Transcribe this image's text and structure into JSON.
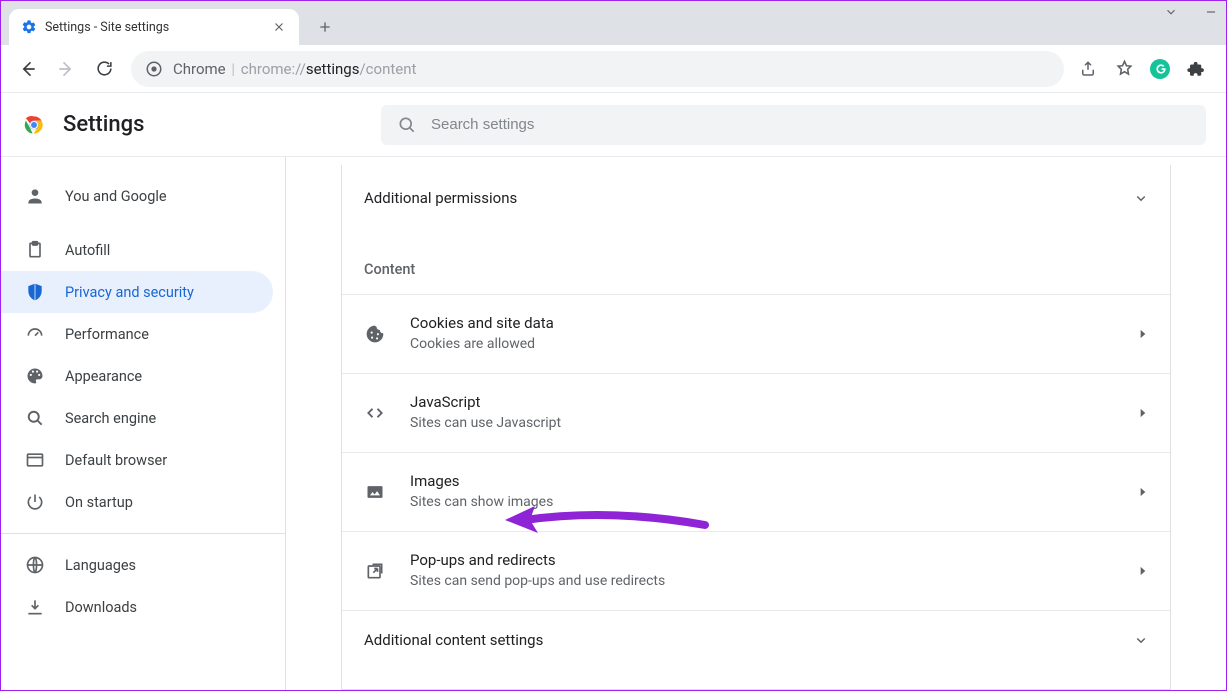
{
  "window": {
    "tab_title": "Settings - Site settings"
  },
  "toolbar": {
    "url_host": "Chrome",
    "url_grey1": "chrome://",
    "url_dark": "settings",
    "url_grey2": "/content"
  },
  "header": {
    "title": "Settings",
    "search_placeholder": "Search settings"
  },
  "sidebar": {
    "items": [
      {
        "label": "You and Google"
      },
      {
        "label": "Autofill"
      },
      {
        "label": "Privacy and security"
      },
      {
        "label": "Performance"
      },
      {
        "label": "Appearance"
      },
      {
        "label": "Search engine"
      },
      {
        "label": "Default browser"
      },
      {
        "label": "On startup"
      }
    ],
    "extra": [
      {
        "label": "Languages"
      },
      {
        "label": "Downloads"
      }
    ]
  },
  "main": {
    "additional_permissions": "Additional permissions",
    "content_label": "Content",
    "rows": [
      {
        "title": "Cookies and site data",
        "sub": "Cookies are allowed"
      },
      {
        "title": "JavaScript",
        "sub": "Sites can use Javascript"
      },
      {
        "title": "Images",
        "sub": "Sites can show images"
      },
      {
        "title": "Pop-ups and redirects",
        "sub": "Sites can send pop-ups and use redirects"
      }
    ],
    "additional_content": "Additional content settings"
  }
}
